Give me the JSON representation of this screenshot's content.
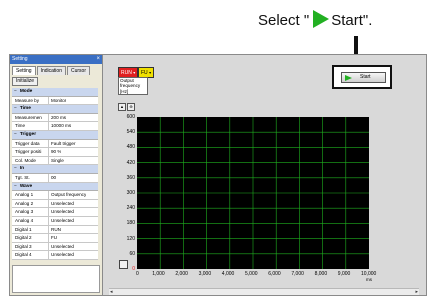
{
  "instruction": {
    "before": "Select \"",
    "after": "Start\"."
  },
  "panel": {
    "title": "Setting",
    "close_glyph": "×",
    "tabs": [
      "Setting",
      "Indication",
      "Cursor"
    ],
    "init_button": "Initialize",
    "sections": [
      {
        "toggle": "−",
        "label": "Mode",
        "rows": [
          {
            "k": "Measure by",
            "v": "Monitor"
          }
        ]
      },
      {
        "toggle": "−",
        "label": "Time",
        "rows": [
          {
            "k": "Measuremen",
            "v": "200 ms"
          },
          {
            "k": "Time",
            "v": "10000 ms"
          }
        ]
      },
      {
        "toggle": "−",
        "label": "Trigger",
        "rows": [
          {
            "k": "Trigger data",
            "v": "Fault trigger"
          },
          {
            "k": "Trigger positi",
            "v": "90 %"
          },
          {
            "k": "Col. Mode",
            "v": "Single"
          }
        ]
      },
      {
        "toggle": "−",
        "label": "In",
        "rows": [
          {
            "k": "Tgt. St.",
            "v": "00"
          }
        ]
      },
      {
        "toggle": "−",
        "label": "Wave",
        "rows": [
          {
            "k": "Analog 1",
            "v": "Output frequency"
          },
          {
            "k": "Analog 2",
            "v": "Unselected"
          },
          {
            "k": "Analog 3",
            "v": "Unselected"
          },
          {
            "k": "Analog 4",
            "v": "Unselected"
          },
          {
            "k": "Digital 1",
            "v": "RUN"
          },
          {
            "k": "Digital 2",
            "v": "FU"
          },
          {
            "k": "Digital 3",
            "v": "Unselected"
          },
          {
            "k": "Digital 4",
            "v": "Unselected"
          }
        ]
      }
    ]
  },
  "chart_toolbar": {
    "tag_run": "RUN",
    "tag_fu": "FU",
    "legend_lines": [
      "Output",
      "frequency",
      "[Hz]"
    ]
  },
  "start_button": {
    "label": "Start"
  },
  "chart_data": {
    "type": "line",
    "title": "",
    "ylabel": "Output frequency [Hz]",
    "xlabel": "ms",
    "y_ticks": [
      "600",
      "540",
      "480",
      "420",
      "360",
      "300",
      "240",
      "180",
      "120",
      "60",
      "0"
    ],
    "x_ticks": [
      "0",
      "1,000",
      "2,000",
      "3,000",
      "4,000",
      "5,000",
      "6,000",
      "7,000",
      "8,000",
      "9,000",
      "10,000"
    ],
    "ylim": [
      0,
      600
    ],
    "xlim": [
      0,
      10000
    ],
    "x_unit": "ms",
    "grid": true,
    "background": "#000000",
    "grid_color": "#1fb01f",
    "series": []
  },
  "colors": {
    "run_tag": "#e02020",
    "fu_tag": "#f0e000",
    "start_triangle": "#22b022",
    "titlebar": "#3a6fc4"
  }
}
